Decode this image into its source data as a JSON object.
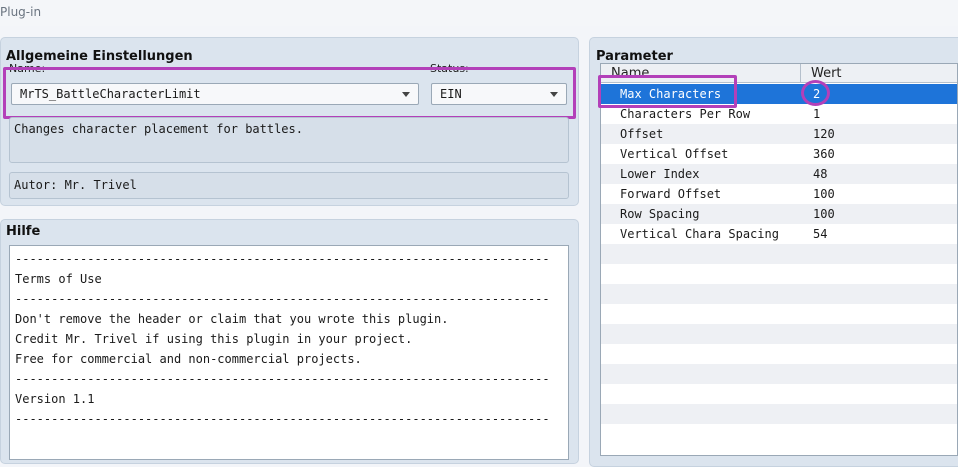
{
  "window": {
    "title": "Plug-in"
  },
  "general": {
    "title": "Allgemeine Einstellungen",
    "name_label": "Name:",
    "name_value": "MrTS_BattleCharacterLimit",
    "status_label": "Status:",
    "status_value": "EIN",
    "description": "Changes character placement for battles.",
    "author": "Autor: Mr. Trivel"
  },
  "help": {
    "title": "Hilfe",
    "lines": [
      "--------------------------------------------------------------------------",
      "Terms of Use",
      "--------------------------------------------------------------------------",
      "Don't remove the header or claim that you wrote this plugin.",
      "Credit Mr. Trivel if using this plugin in your project.",
      "Free for commercial and non-commercial projects.",
      "--------------------------------------------------------------------------",
      "Version 1.1",
      "--------------------------------------------------------------------------"
    ]
  },
  "parameters": {
    "title": "Parameter",
    "columns": [
      "Name",
      "Wert"
    ],
    "rows": [
      {
        "name": "Max Characters",
        "value": "2"
      },
      {
        "name": "Characters Per Row",
        "value": "1"
      },
      {
        "name": "Offset",
        "value": "120"
      },
      {
        "name": "Vertical Offset",
        "value": "360"
      },
      {
        "name": "Lower Index",
        "value": "48"
      },
      {
        "name": "Forward Offset",
        "value": "100"
      },
      {
        "name": "Row Spacing",
        "value": "100"
      },
      {
        "name": "Vertical Chara Spacing",
        "value": "54"
      }
    ],
    "selected_index": 0
  },
  "colors": {
    "selection": "#1e74d9",
    "annotation": "#b340b9"
  }
}
